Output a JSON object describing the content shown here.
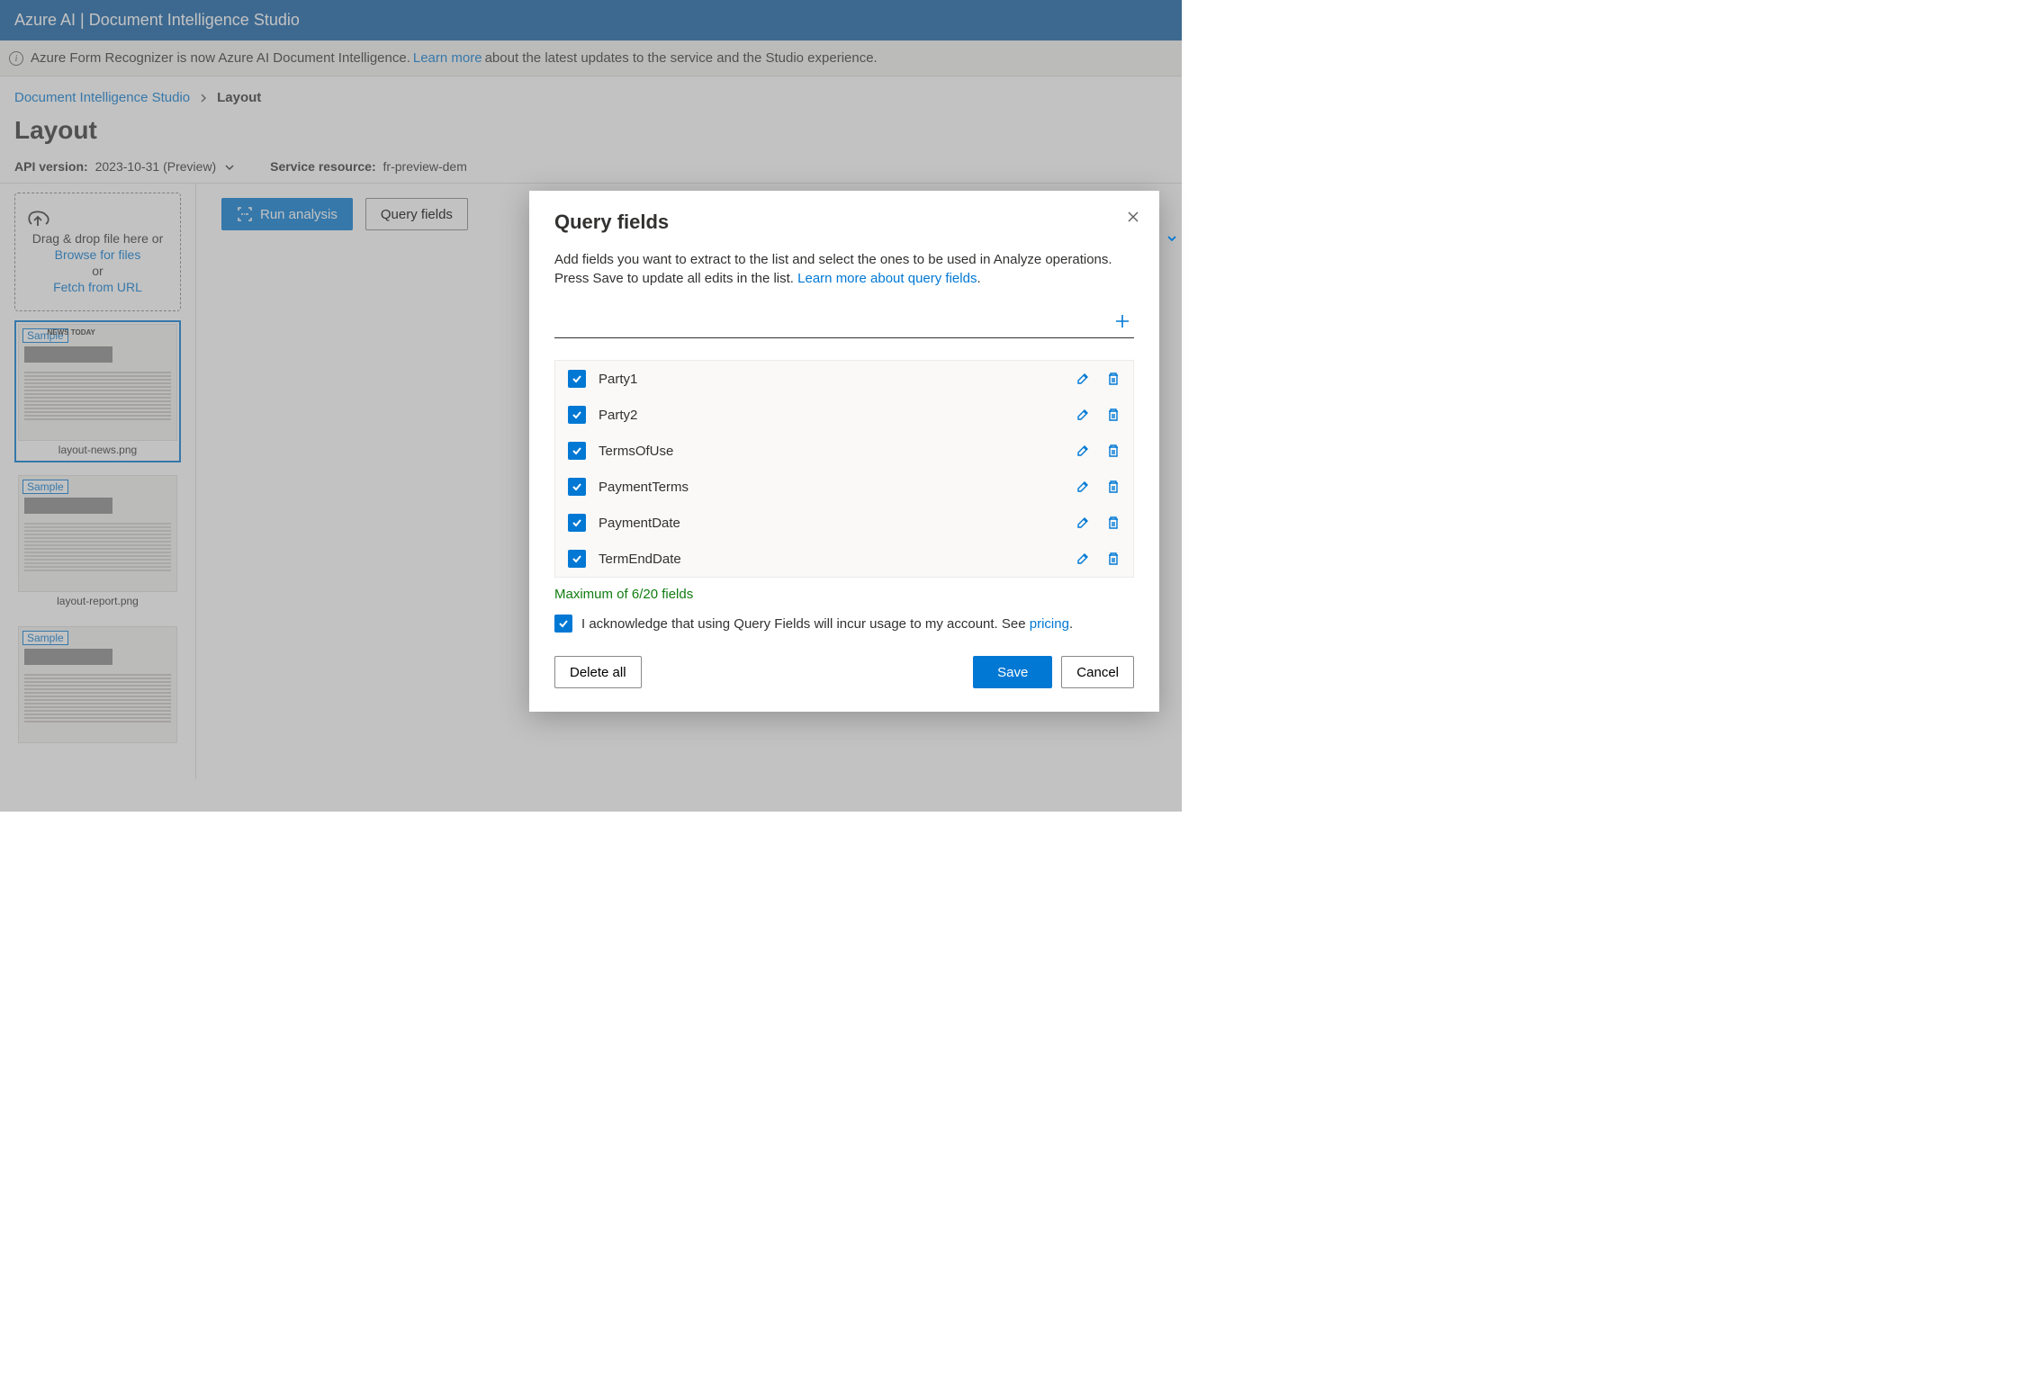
{
  "header": {
    "brand": "Azure AI | Document Intelligence Studio"
  },
  "info_banner": {
    "prefix": "Azure Form Recognizer is now Azure AI Document Intelligence. ",
    "link": "Learn more",
    "suffix": " about the latest updates to the service and the Studio experience."
  },
  "breadcrumb": {
    "root": "Document Intelligence Studio",
    "current": "Layout"
  },
  "page": {
    "title": "Layout",
    "api_version_label": "API version:",
    "api_version_value": "2023-10-31 (Preview)",
    "service_resource_label": "Service resource:",
    "service_resource_value": "fr-preview-dem"
  },
  "dropzone": {
    "line1": "Drag & drop file here or",
    "browse": "Browse for files",
    "or": "or",
    "fetch": "Fetch from URL"
  },
  "thumbs": [
    {
      "badge": "Sample",
      "title": "NEWS TODAY",
      "name": "layout-news.png",
      "selected": true
    },
    {
      "badge": "Sample",
      "title": "",
      "name": "layout-report.png",
      "selected": false
    },
    {
      "badge": "Sample",
      "title": "",
      "name": "",
      "selected": false
    }
  ],
  "toolbar": {
    "run": "Run analysis",
    "query": "Query fields"
  },
  "modal": {
    "title": "Query fields",
    "desc_prefix": "Add fields you want to extract to the list and select the ones to be used in Analyze operations. Press Save to update all edits in the list. ",
    "desc_link": "Learn more about query fields",
    "fields": [
      {
        "name": "Party1",
        "checked": true
      },
      {
        "name": "Party2",
        "checked": true
      },
      {
        "name": "TermsOfUse",
        "checked": true
      },
      {
        "name": "PaymentTerms",
        "checked": true
      },
      {
        "name": "PaymentDate",
        "checked": true
      },
      {
        "name": "TermEndDate",
        "checked": true
      }
    ],
    "max_text": "Maximum of 6/20 fields",
    "ack_text": "I acknowledge that using Query Fields will incur usage to my account. See ",
    "ack_link": "pricing",
    "delete_all": "Delete all",
    "save": "Save",
    "cancel": "Cancel"
  }
}
